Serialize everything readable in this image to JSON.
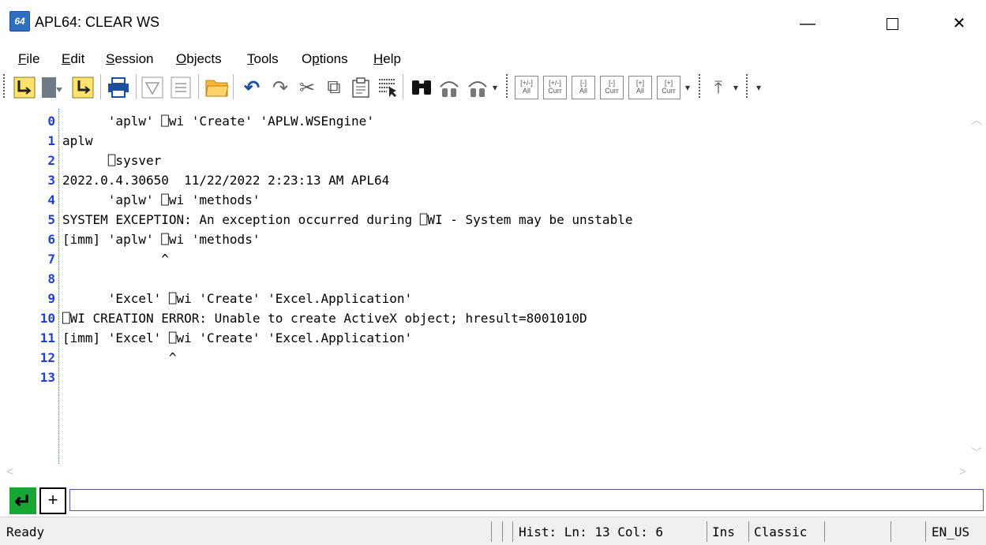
{
  "window": {
    "icon_label": "64",
    "title": "APL64: CLEAR WS",
    "minimize_glyph": "—",
    "close_glyph": "✕"
  },
  "menu": {
    "items": [
      {
        "label": "File",
        "key": "F",
        "rest": "ile"
      },
      {
        "label": "Edit",
        "key": "E",
        "rest": "dit"
      },
      {
        "label": "Session",
        "key": "S",
        "rest": "ession"
      },
      {
        "label": "Objects",
        "key": "O",
        "rest": "bjects"
      },
      {
        "label": "Tools",
        "key": "T",
        "rest": "ools"
      },
      {
        "label": "Options",
        "key": "p",
        "pre": "O",
        "rest": "tions"
      },
      {
        "label": "Help",
        "key": "H",
        "rest": "elp"
      }
    ]
  },
  "toolbar": {
    "icons": [
      "step-into-icon",
      "step-over-icon",
      "step-out-icon",
      "print-icon",
      "filter-icon",
      "document-icon",
      "open-folder-icon",
      "undo-icon",
      "redo-icon",
      "cut-icon",
      "copy-icon",
      "paste-icon",
      "select-icon",
      "find-icon",
      "find-previous-icon",
      "find-next-icon"
    ],
    "mini_buttons": [
      {
        "top": "[+/-]",
        "bottom": "All"
      },
      {
        "top": "[+/-]",
        "bottom": "Curr"
      },
      {
        "top": "[-]",
        "bottom": "All"
      },
      {
        "top": "[-]",
        "bottom": "Curr"
      },
      {
        "top": "[+]",
        "bottom": "All"
      },
      {
        "top": "[+]",
        "bottom": "Curr"
      }
    ],
    "glyphs": {
      "undo": "↶",
      "redo": "↷",
      "cut": "✂",
      "copy": "⧉",
      "paste": "📋",
      "find": "🔍",
      "top": "⤒",
      "dropdown": "▾"
    }
  },
  "session": {
    "lines": [
      {
        "n": "0",
        "text": "      'aplw' ⎕wi 'Create' 'APLW.WSEngine'"
      },
      {
        "n": "1",
        "text": "aplw"
      },
      {
        "n": "2",
        "text": "      ⎕sysver"
      },
      {
        "n": "3",
        "text": "2022.0.4.30650  11/22/2022 2:23:13 AM APL64"
      },
      {
        "n": "4",
        "text": "      'aplw' ⎕wi 'methods'"
      },
      {
        "n": "5",
        "text": "SYSTEM EXCEPTION: An exception occurred during ⎕WI - System may be unstable"
      },
      {
        "n": "6",
        "text": "[imm] 'aplw' ⎕wi 'methods'"
      },
      {
        "n": "7",
        "text": "             ^"
      },
      {
        "n": "8",
        "text": ""
      },
      {
        "n": "9",
        "text": "      'Excel' ⎕wi 'Create' 'Excel.Application'"
      },
      {
        "n": "10",
        "text": "⎕WI CREATION ERROR: Unable to create ActiveX object; hresult=8001010D"
      },
      {
        "n": "11",
        "text": "[imm] 'Excel' ⎕wi 'Create' 'Excel.Application'"
      },
      {
        "n": "12",
        "text": "              ^"
      },
      {
        "n": "13",
        "text": ""
      }
    ]
  },
  "input": {
    "exec_glyph": "↵",
    "plus_glyph": "+",
    "value": ""
  },
  "statusbar": {
    "ready": "Ready",
    "position": "Hist: Ln: 13 Col: 6",
    "mode": "Ins",
    "keyboard": "Classic",
    "locale": "EN_US"
  }
}
